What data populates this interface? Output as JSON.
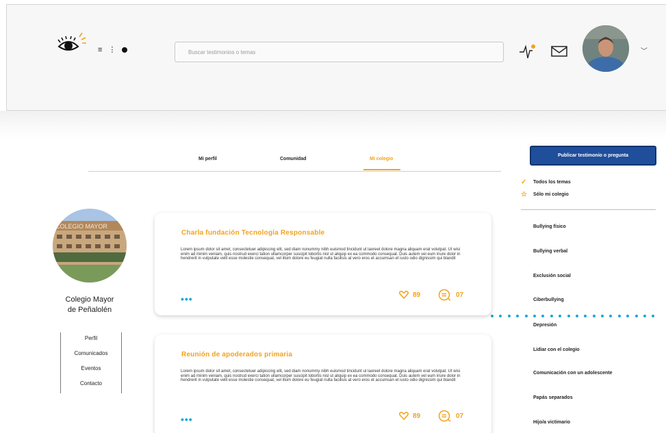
{
  "header": {
    "search_placeholder": "Buscar testimonios o temas",
    "menu_glyph": "≡",
    "more_glyph": "⋮",
    "chevron_glyph": "﹀"
  },
  "tabs": [
    {
      "label": "Mi perfil",
      "active": false
    },
    {
      "label": "Comunidad",
      "active": false
    },
    {
      "label": "Mi colegio",
      "active": true
    }
  ],
  "school": {
    "name_line1": "Colegio Mayor",
    "name_line2": "de Peñalolén",
    "photo_sign": "COLEGIO MAYOR"
  },
  "side_menu": [
    "Perfil",
    "Comunicados",
    "Eventos",
    "Contacto"
  ],
  "posts": [
    {
      "title": "Charla fundación Tecnología Responsable",
      "body": "Lorem ipsum dolor sit amet, consectetuer adipiscing elit, sed diam nonummy nibh euismod tincidunt ut laoreet dolore magna aliquam erat volutpat. Ut wisi enim ad minim veniam, quis nostrud exerci tation ullamcorper suscipit lobortis nisl ut aliquip ex ea commodo consequat. Duis autem vel eum iriure dolor in hendrerit in vulputate velit esse molestie consequat, vel illum dolore eu feugiat nulla facilisis at vero eros et accumsan et iusto odio dignissim qui blandit",
      "likes": "89",
      "comments": "07",
      "more": "•••"
    },
    {
      "title": "Reunión de apoderados primaria",
      "body": "Lorem ipsum dolor sit amet, consectetuer adipiscing elit, sed diam nonummy nibh euismod tincidunt ut laoreet dolore magna aliquam erat volutpat. Ut wisi enim ad minim veniam, quis nostrud exerci tation ullamcorper suscipit lobortis nisl ut aliquip ex ea commodo consequat. Duis autem vel eum iriure dolor in hendrerit in vulputate velit esse molestie consequat, vel illum dolore eu feugiat nulla facilisis at vero eros et accumsan et iusto odio dignissim qui blandit",
      "likes": "89",
      "comments": "07",
      "more": "•••"
    }
  ],
  "sidebar": {
    "publish_label": "Publicar testimonio o pregunta",
    "filters": [
      {
        "label": "Todos los temas",
        "icon": "check-icon"
      },
      {
        "label": "Sólo mi colegio",
        "icon": "star-icon"
      }
    ],
    "topics": [
      "Bullying físico",
      "Bullying verbal",
      "Exclusión social",
      "Ciberbullying",
      "Depresión",
      "Lidiar con el colegio",
      "Comunicación con un adolescente",
      "Papás separados",
      "Hijo/a victimario"
    ]
  },
  "colors": {
    "accent": "#f2a21d",
    "primary": "#1f4e9b",
    "link_dots": "#1aa6d6"
  }
}
